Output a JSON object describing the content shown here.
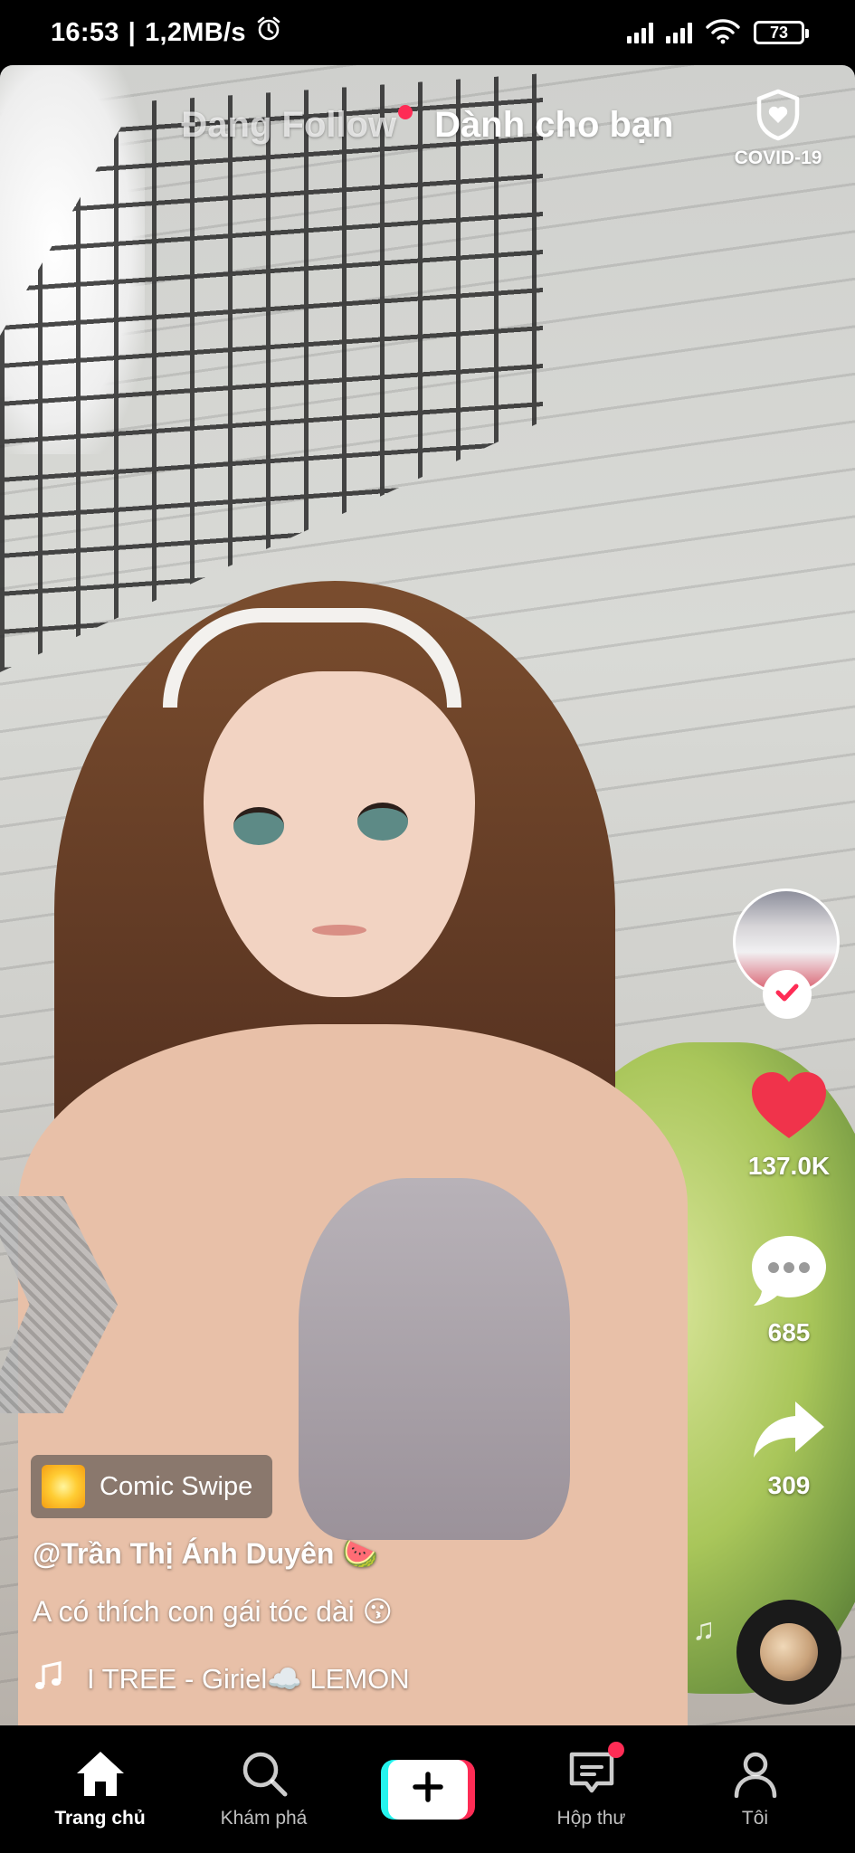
{
  "status_bar": {
    "time": "16:53",
    "separator": "|",
    "speed": "1,2MB/s",
    "battery": "73"
  },
  "top_tabs": {
    "following": "Đang Follow",
    "for_you": "Dành cho bạn",
    "covid": "COVID-19"
  },
  "actions": {
    "likes": "137.0K",
    "comments": "685",
    "shares": "309"
  },
  "video_info": {
    "effect": "Comic Swipe",
    "username": "@Trần Thị Ánh Duyên 🍉",
    "caption": "A có thích con gái tóc dài 😗",
    "music": "I TREE - Giriel☁️     LEMON"
  },
  "bottom_nav": {
    "home": "Trang chủ",
    "discover": "Khám phá",
    "inbox": "Hộp thư",
    "profile": "Tôi"
  },
  "colors": {
    "accent_red": "#fe2c55",
    "accent_cyan": "#25f4ee",
    "like_red": "#f0334b"
  },
  "icons": [
    "alarm-icon",
    "signal-icon",
    "wifi-icon",
    "battery-icon",
    "shield-heart-icon",
    "heart-icon",
    "comment-icon",
    "share-icon",
    "music-note-icon",
    "home-icon",
    "search-icon",
    "plus-icon",
    "inbox-icon",
    "profile-icon",
    "check-icon"
  ]
}
